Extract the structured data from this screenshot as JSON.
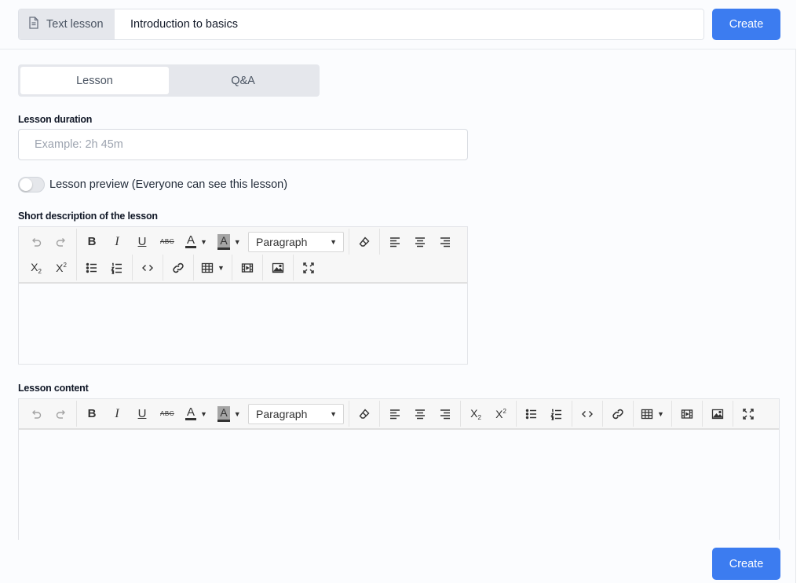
{
  "header": {
    "type_label": "Text lesson",
    "type_icon": "document-icon",
    "title_value": "Introduction to basics",
    "create_label": "Create"
  },
  "tabs": [
    {
      "label": "Lesson",
      "active": true
    },
    {
      "label": "Q&A",
      "active": false
    }
  ],
  "duration": {
    "label": "Lesson duration",
    "placeholder": "Example: 2h 45m",
    "value": ""
  },
  "preview_toggle": {
    "label": "Lesson preview (Everyone can see this lesson)",
    "on": false
  },
  "short_description": {
    "label": "Short description of the lesson",
    "format_value": "Paragraph",
    "content": ""
  },
  "lesson_content": {
    "label": "Lesson content",
    "format_value": "Paragraph",
    "content": ""
  },
  "footer": {
    "create_label": "Create"
  },
  "colors": {
    "primary": "#3c7cf0",
    "panel_bg": "#fbfcfe",
    "addon_bg": "#e5e7ec"
  }
}
